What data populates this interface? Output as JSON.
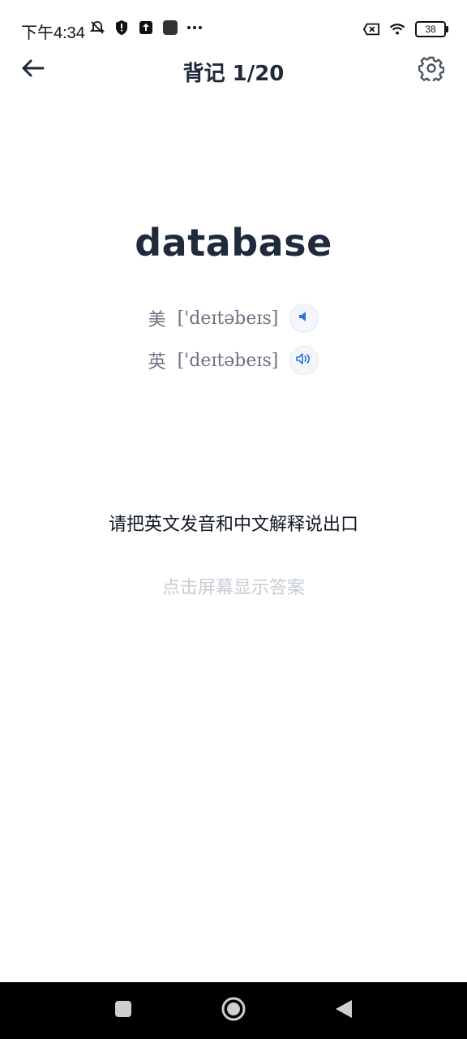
{
  "status": {
    "time": "下午4:34",
    "battery": "38",
    "icons": [
      "bell-off-icon",
      "shield-icon",
      "upload-icon",
      "app-icon",
      "more-icon",
      "sim-icon",
      "wifi-icon",
      "battery-icon"
    ]
  },
  "header": {
    "title": "背记 1/20"
  },
  "word": {
    "text": "database",
    "us_label": "美",
    "us_pron": "['deɪtəbeɪs]",
    "uk_label": "英",
    "uk_pron": "['deɪtəbeɪs]"
  },
  "instruction": "请把英文发音和中文解释说出口",
  "hint": "点击屏幕显示答案",
  "colors": {
    "accent": "#2f6fe0",
    "text": "#1f2a3d",
    "muted": "#6b7280",
    "hint": "#c7cdd3"
  }
}
